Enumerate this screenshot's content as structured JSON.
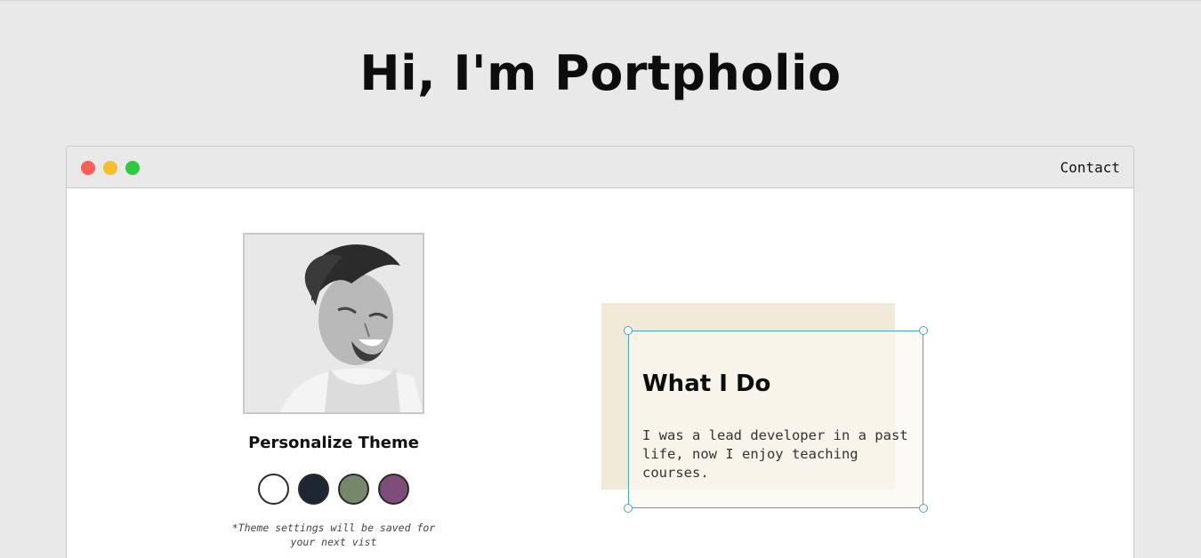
{
  "hero": {
    "title": "Hi, I'm Portpholio"
  },
  "window": {
    "nav": {
      "contact_label": "Contact"
    }
  },
  "profile": {
    "personalize_title": "Personalize Theme",
    "theme_swatches": [
      {
        "name": "light",
        "color": "#ffffff"
      },
      {
        "name": "dark",
        "color": "#1c2733"
      },
      {
        "name": "green",
        "color": "#77876b"
      },
      {
        "name": "purple",
        "color": "#7e4c7a"
      }
    ],
    "theme_note": "*Theme settings will be saved for your next vist"
  },
  "about": {
    "title": "What I Do",
    "text": "I was a lead developer in a past life, now I enjoy teaching courses."
  },
  "colors": {
    "page_bg": "#e9e9e9",
    "card_bg": "#f1ead8",
    "selection": "#4aa3c8",
    "dot_red": "#f5605a",
    "dot_yellow": "#f6bd2f",
    "dot_green": "#2ec940"
  }
}
